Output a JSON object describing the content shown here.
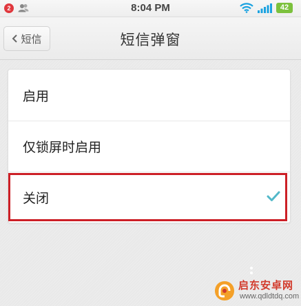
{
  "status_bar": {
    "notification_count": "2",
    "time": "8:04 PM",
    "battery": "42",
    "icons": [
      "contacts-icon",
      "wifi-icon",
      "signal-icon"
    ]
  },
  "nav": {
    "back_label": "短信",
    "title": "短信弹窗"
  },
  "options": [
    {
      "label": "启用",
      "selected": false
    },
    {
      "label": "仅锁屏时启用",
      "selected": false
    },
    {
      "label": "关闭",
      "selected": true
    }
  ],
  "watermark": {
    "title": "启东安卓网",
    "url": "www.qdldtdq.com"
  },
  "colors": {
    "check": "#52b8c9",
    "highlight_border": "#cc1f26",
    "badge": "#e0383e",
    "battery": "#7cc13d"
  }
}
